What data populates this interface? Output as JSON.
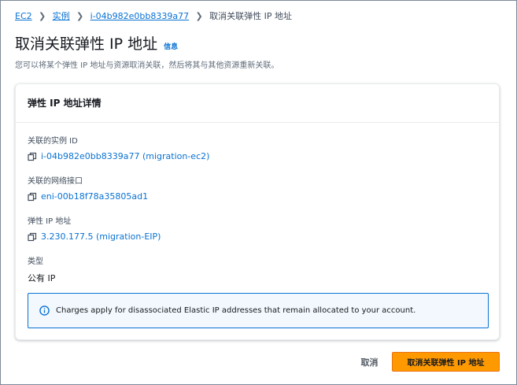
{
  "breadcrumb": {
    "items": [
      "EC2",
      "实例",
      "i-04b982e0bb8339a77"
    ],
    "current": "取消关联弹性 IP 地址"
  },
  "header": {
    "title": "取消关联弹性 IP 地址",
    "info": "信息",
    "description": "您可以将某个弹性 IP 地址与资源取消关联，然后将其与其他资源重新关联。"
  },
  "panel": {
    "title": "弹性 IP 地址详情",
    "fields": [
      {
        "label": "关联的实例 ID",
        "value": "i-04b982e0bb8339a77 (migration-ec2)",
        "icon": "copy-icon"
      },
      {
        "label": "关联的网络接口",
        "value": "eni-00b18f78a35805ad1",
        "icon": "copy-icon"
      },
      {
        "label": "弹性 IP 地址",
        "value": "3.230.177.5 (migration-EIP)",
        "icon": "copy-icon"
      },
      {
        "label": "类型",
        "value": "公有 IP"
      }
    ],
    "alert": {
      "icon": "info-circle-icon",
      "text": "Charges apply for disassociated Elastic IP addresses that remain allocated to your account."
    }
  },
  "actions": {
    "cancel": "取消",
    "primary": "取消关联弹性 IP 地址"
  },
  "colors": {
    "link": "#0972d3",
    "primary_button": "#ff9900",
    "alert_border": "#0972d3",
    "alert_bg": "#f2f8fd"
  }
}
